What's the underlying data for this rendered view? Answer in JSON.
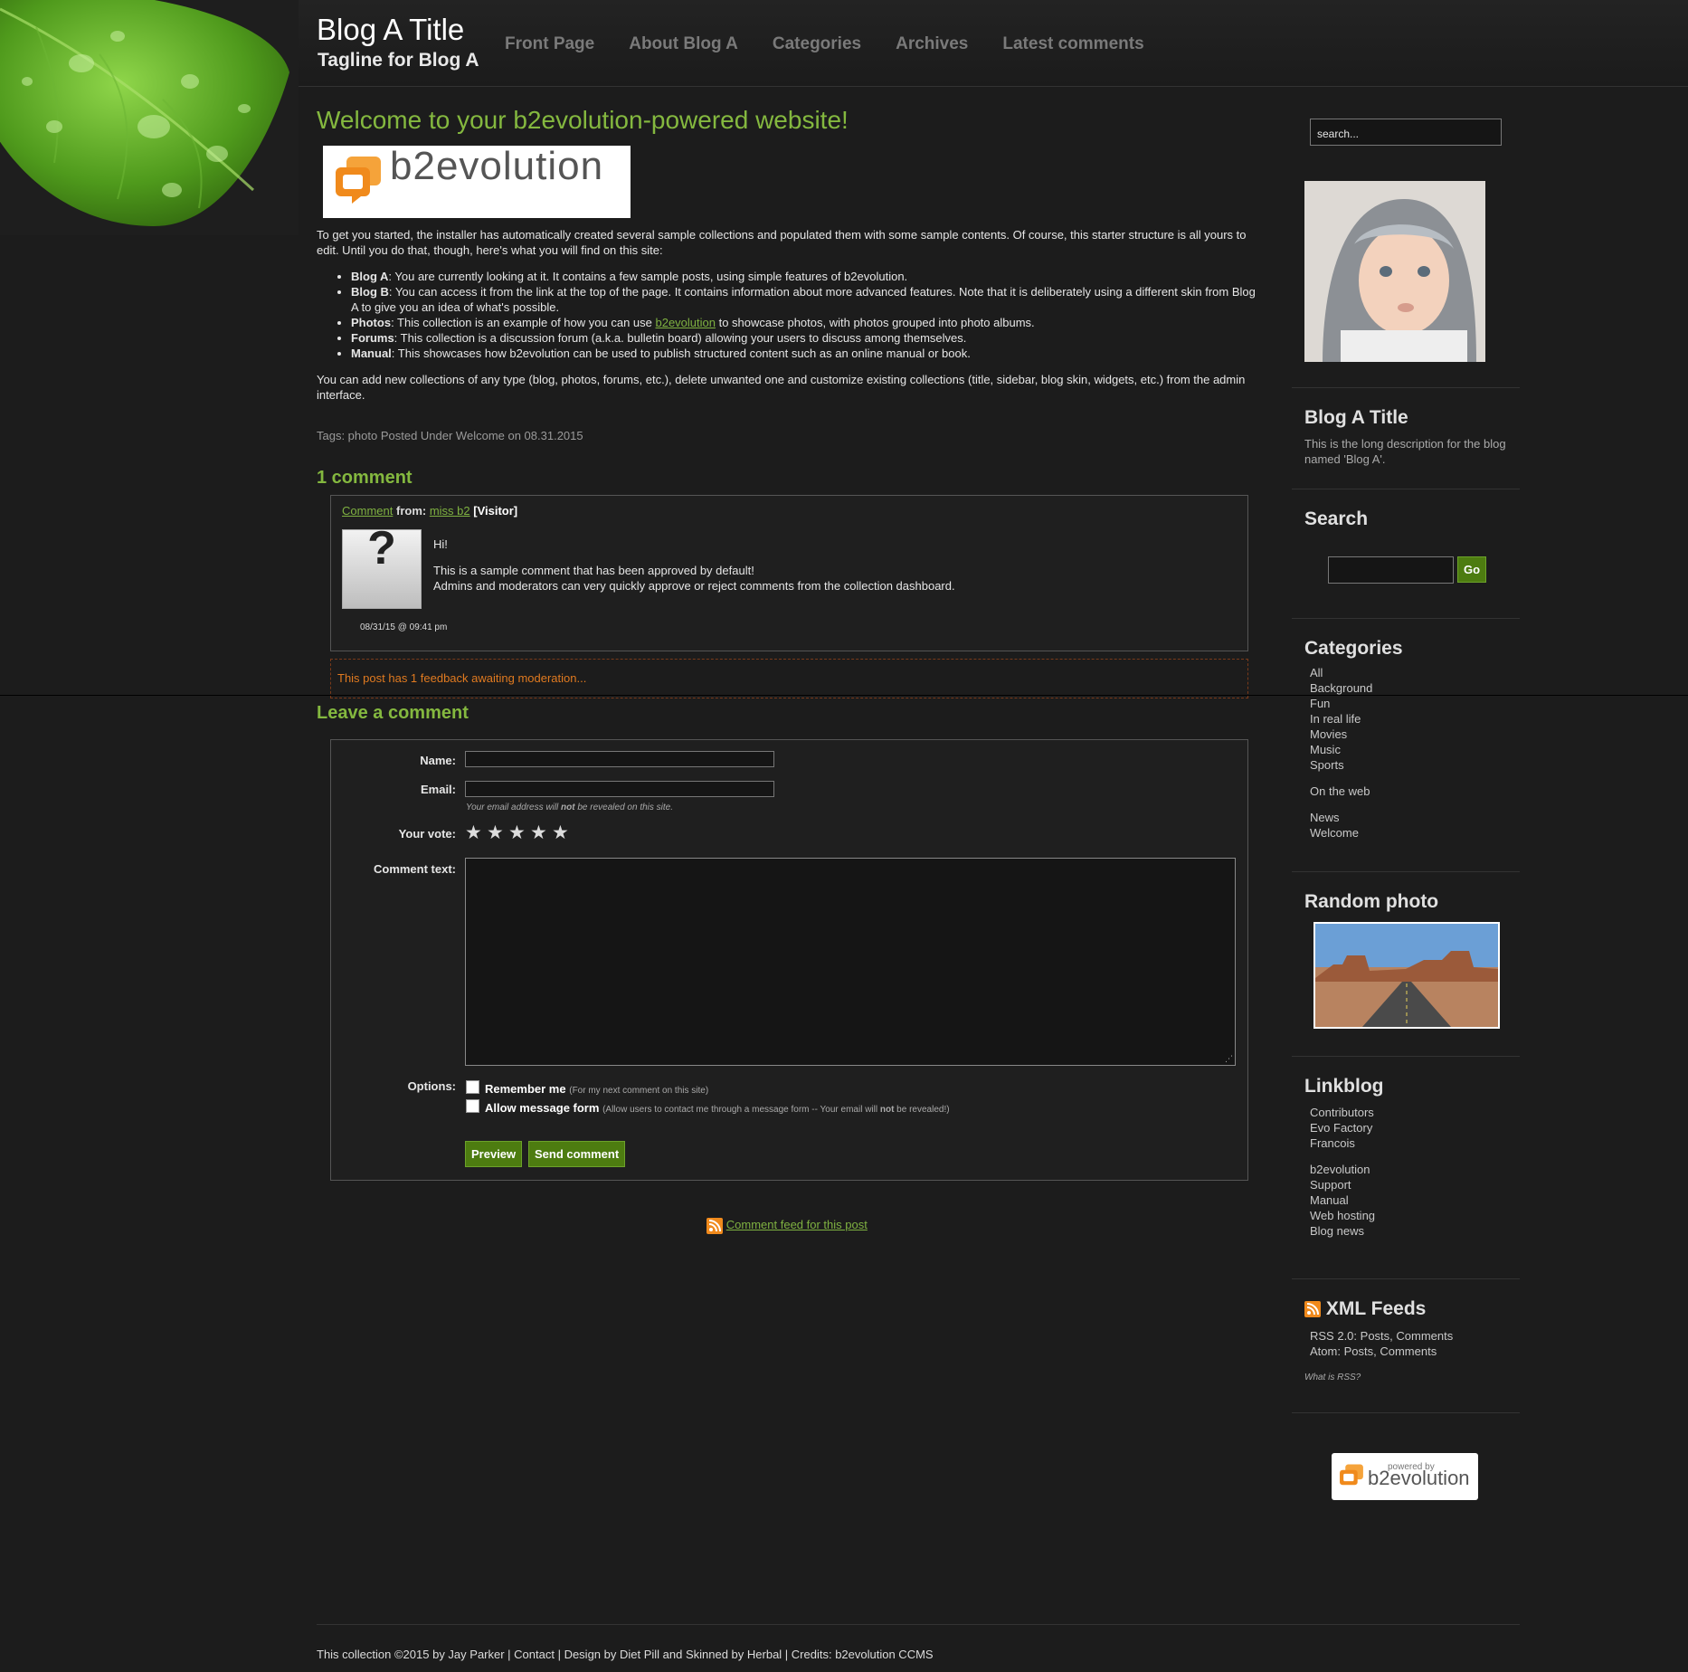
{
  "header": {
    "title": "Blog A Title",
    "tagline": "Tagline for Blog A",
    "nav": [
      "Front Page",
      "About Blog A",
      "Categories",
      "Archives",
      "Latest comments"
    ]
  },
  "post": {
    "title": "Welcome to your b2evolution-powered website!",
    "logo_text": "b2evolution",
    "intro": "To get you started, the installer has automatically created several sample collections and populated them with some sample contents. Of course, this starter structure is all yours to edit. Until you do that, though, here's what you will find on this site:",
    "items": [
      {
        "label": "Blog A",
        "text": ": You are currently looking at it. It contains a few sample posts, using simple features of b2evolution."
      },
      {
        "label": "Blog B",
        "text": ": You can access it from the link at the top of the page. It contains information about more advanced features. Note that it is deliberately using a different skin from Blog A to give you an idea of what's possible."
      },
      {
        "label": "Photos",
        "text_before": ": This collection is an example of how you can use ",
        "link": "b2evolution",
        "text_after": " to showcase photos, with photos grouped into photo albums."
      },
      {
        "label": "Forums",
        "text": ": This collection is a discussion forum (a.k.a. bulletin board) allowing your users to discuss among themselves."
      },
      {
        "label": "Manual",
        "text": ": This showcases how b2evolution can be used to publish structured content such as an online manual or book."
      }
    ],
    "outro": "You can add new collections of any type (blog, photos, forums, etc.), delete unwanted one and customize existing collections (title, sidebar, blog skin, widgets, etc.) from the admin interface.",
    "tags_line": "Tags: photo Posted Under Welcome on 08.31.2015"
  },
  "comments": {
    "heading": "1 comment",
    "comment_link": "Comment",
    "from_label": "from:",
    "author": "miss b2",
    "author_type": "[Visitor]",
    "avatar_glyph": "?",
    "body_line1": "Hi!",
    "body_line2": "This is a sample comment that has been approved by default!",
    "body_line3": "Admins and moderators can very quickly approve or reject comments from the collection dashboard.",
    "date": "08/31/15 @ 09:41 pm",
    "moderation_notice": "This post has 1 feedback awaiting moderation..."
  },
  "form": {
    "heading": "Leave a comment",
    "name_label": "Name:",
    "email_label": "Email:",
    "email_note_pre": "Your email address will ",
    "email_note_bold": "not",
    "email_note_post": " be revealed on this site.",
    "vote_label": "Your vote:",
    "vote_value": 0,
    "comment_label": "Comment text:",
    "options_label": "Options:",
    "remember_label": "Remember me",
    "remember_note": "(For my next comment on this site)",
    "allow_label": "Allow message form",
    "allow_note_pre": "(Allow users to contact me through a message form -- Your email will ",
    "allow_note_bold": "not",
    "allow_note_post": " be revealed!)",
    "preview_button": "Preview",
    "send_button": "Send comment",
    "feed_link": "Comment feed for this post"
  },
  "sidebar": {
    "search_placeholder": "search...",
    "blog_title": "Blog A Title",
    "blog_desc": "This is the long description for the blog named 'Blog A'.",
    "search_heading": "Search",
    "go_button": "Go",
    "categories_heading": "Categories",
    "categories": [
      "All",
      "Background",
      "Fun",
      "In real life",
      "Movies",
      "Music",
      "Sports"
    ],
    "categories_group2": [
      "On the web"
    ],
    "categories_group3": [
      "News",
      "Welcome"
    ],
    "random_photo_heading": "Random photo",
    "linkblog_heading": "Linkblog",
    "linkblog_group1": [
      "Contributors",
      "Evo Factory",
      "Francois"
    ],
    "linkblog_group2": [
      "b2evolution",
      "Support",
      "Manual",
      "Web hosting",
      "Blog news"
    ],
    "xml_heading": "XML Feeds",
    "rss_label": "RSS 2.0:",
    "atom_label": "Atom:",
    "posts_link": "Posts",
    "comments_link": "Comments",
    "what_is_rss": "What is RSS?",
    "powered_by": "powered by",
    "powered_logo": "b2evolution"
  },
  "footer": {
    "text": "This collection ©2015 by Jay Parker | Contact | Design by Diet Pill and Skinned by Herbal | Credits: b2evolution CCMS"
  },
  "colors": {
    "accent_green": "#84b83f",
    "button_green": "#4d7c10",
    "moderation_orange": "#e07a20",
    "background": "#1c1c1c"
  }
}
